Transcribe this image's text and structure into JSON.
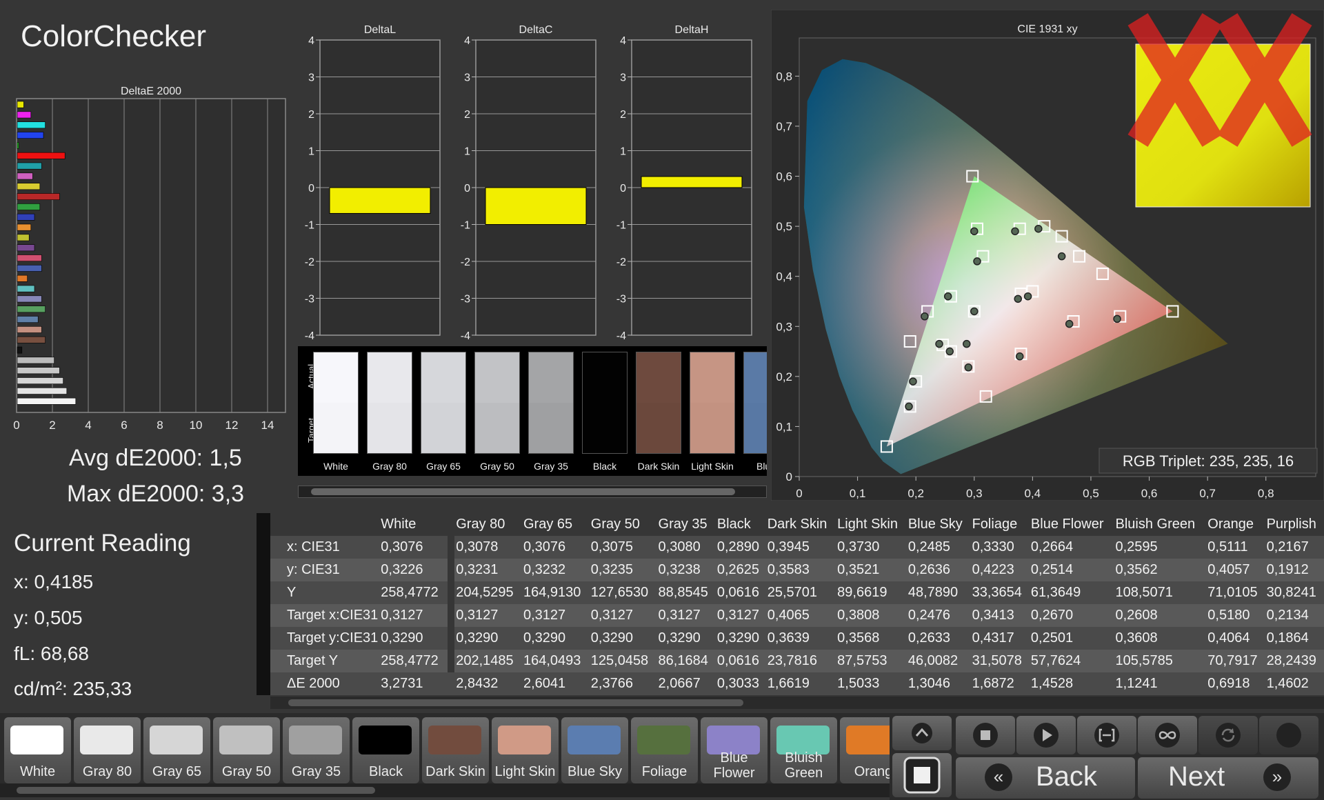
{
  "app": {
    "title": "ColorChecker"
  },
  "stats": {
    "avg": "Avg dE2000: 1,5",
    "max": "Max dE2000: 3,3"
  },
  "current_reading": {
    "title": "Current Reading",
    "x": "x: 0,4185",
    "y": "y: 0,505",
    "fl": "fL: 68,68",
    "cdm2": "cd/m²: 235,33"
  },
  "colors": {
    "delta_bar": "#f2ee00",
    "bg": "#363636",
    "plot_bg": "#2e2e2e"
  },
  "chart_data": [
    {
      "type": "bar",
      "orientation": "horizontal",
      "title": "DeltaE 2000",
      "xlim": [
        0,
        15
      ],
      "xticks": [
        0,
        2,
        4,
        6,
        8,
        10,
        12,
        14
      ],
      "grid": true,
      "values": [
        {
          "v": 0.4,
          "c": "#e8e800"
        },
        {
          "v": 0.8,
          "c": "#ee22ee"
        },
        {
          "v": 1.6,
          "c": "#22e0e0"
        },
        {
          "v": 1.5,
          "c": "#2244ee"
        },
        {
          "v": 0.1,
          "c": "#22cc22"
        },
        {
          "v": 2.7,
          "c": "#ee1111"
        },
        {
          "v": 1.4,
          "c": "#20a0a8"
        },
        {
          "v": 0.9,
          "c": "#d060c0"
        },
        {
          "v": 1.3,
          "c": "#d8cc30"
        },
        {
          "v": 2.4,
          "c": "#b82828"
        },
        {
          "v": 1.3,
          "c": "#30a040"
        },
        {
          "v": 1.0,
          "c": "#3040b8"
        },
        {
          "v": 0.8,
          "c": "#e89030"
        },
        {
          "v": 0.7,
          "c": "#c0c030"
        },
        {
          "v": 1.0,
          "c": "#784890"
        },
        {
          "v": 1.4,
          "c": "#d05070"
        },
        {
          "v": 1.4,
          "c": "#4860b0"
        },
        {
          "v": 0.6,
          "c": "#e07828"
        },
        {
          "v": 1.0,
          "c": "#60c0c0"
        },
        {
          "v": 1.4,
          "c": "#8888b8"
        },
        {
          "v": 1.6,
          "c": "#58a060"
        },
        {
          "v": 1.2,
          "c": "#6080a8"
        },
        {
          "v": 1.4,
          "c": "#c49080"
        },
        {
          "v": 1.6,
          "c": "#785040"
        },
        {
          "v": 0.3,
          "c": "#111111"
        },
        {
          "v": 2.1,
          "c": "#bbbbbb"
        },
        {
          "v": 2.4,
          "c": "#c8c8c8"
        },
        {
          "v": 2.6,
          "c": "#d6d6d6"
        },
        {
          "v": 2.8,
          "c": "#e4e4e4"
        },
        {
          "v": 3.3,
          "c": "#f4f4f4"
        }
      ]
    },
    {
      "type": "bar",
      "title": "DeltaL",
      "ylim": [
        -4,
        4
      ],
      "yticks": [
        4,
        3,
        2,
        1,
        0,
        -1,
        -2,
        -3,
        -4
      ],
      "values": [
        -0.7
      ]
    },
    {
      "type": "bar",
      "title": "DeltaC",
      "ylim": [
        -4,
        4
      ],
      "yticks": [
        4,
        3,
        2,
        1,
        0,
        -1,
        -2,
        -3,
        -4
      ],
      "values": [
        -1.0
      ]
    },
    {
      "type": "bar",
      "title": "DeltaH",
      "ylim": [
        -4,
        4
      ],
      "yticks": [
        4,
        3,
        2,
        1,
        0,
        -1,
        -2,
        -3,
        -4
      ],
      "values": [
        0.3
      ]
    },
    {
      "type": "scatter",
      "title": "CIE 1931 xy",
      "xlim": [
        0,
        0.85
      ],
      "ylim": [
        0,
        0.85
      ],
      "xticks": [
        "0",
        "0,1",
        "0,2",
        "0,3",
        "0,4",
        "0,5",
        "0,6",
        "0,7",
        "0,8"
      ],
      "yticks": [
        "0",
        "0,1",
        "0,2",
        "0,3",
        "0,4",
        "0,5",
        "0,6",
        "0,7",
        "0,8"
      ],
      "targets": [
        [
          0.297,
          0.6
        ],
        [
          0.305,
          0.495
        ],
        [
          0.378,
          0.495
        ],
        [
          0.42,
          0.5
        ],
        [
          0.45,
          0.48
        ],
        [
          0.48,
          0.44
        ],
        [
          0.52,
          0.405
        ],
        [
          0.315,
          0.44
        ],
        [
          0.38,
          0.365
        ],
        [
          0.4,
          0.37
        ],
        [
          0.3,
          0.33
        ],
        [
          0.22,
          0.33
        ],
        [
          0.26,
          0.36
        ],
        [
          0.19,
          0.27
        ],
        [
          0.246,
          0.263
        ],
        [
          0.26,
          0.25
        ],
        [
          0.29,
          0.22
        ],
        [
          0.38,
          0.245
        ],
        [
          0.47,
          0.31
        ],
        [
          0.55,
          0.32
        ],
        [
          0.64,
          0.33
        ],
        [
          0.2,
          0.19
        ],
        [
          0.19,
          0.14
        ],
        [
          0.15,
          0.06
        ],
        [
          0.32,
          0.16
        ]
      ],
      "actuals": [
        [
          0.3,
          0.49
        ],
        [
          0.37,
          0.49
        ],
        [
          0.305,
          0.43
        ],
        [
          0.375,
          0.355
        ],
        [
          0.392,
          0.36
        ],
        [
          0.3,
          0.33
        ],
        [
          0.255,
          0.36
        ],
        [
          0.215,
          0.32
        ],
        [
          0.24,
          0.265
        ],
        [
          0.258,
          0.25
        ],
        [
          0.29,
          0.218
        ],
        [
          0.378,
          0.24
        ],
        [
          0.463,
          0.305
        ],
        [
          0.545,
          0.315
        ],
        [
          0.45,
          0.44
        ],
        [
          0.41,
          0.495
        ],
        [
          0.195,
          0.19
        ],
        [
          0.188,
          0.14
        ],
        [
          0.287,
          0.265
        ]
      ],
      "inset": {
        "color": "#ebeb10",
        "label": "RGB Triplet: 235, 235, 16"
      }
    }
  ],
  "swatch_strip": {
    "actual_label": "Actual",
    "target_label": "Target",
    "swatches": [
      {
        "label": "White",
        "a": "#f7f7fb",
        "t": "#f4f4f8"
      },
      {
        "label": "Gray 80",
        "a": "#e8e8ec",
        "t": "#e4e4e8"
      },
      {
        "label": "Gray 65",
        "a": "#d6d7db",
        "t": "#d2d3d7"
      },
      {
        "label": "Gray 50",
        "a": "#c2c3c6",
        "t": "#bcbdc0"
      },
      {
        "label": "Gray 35",
        "a": "#a4a5a7",
        "t": "#9fa0a2"
      },
      {
        "label": "Black",
        "a": "#020202",
        "t": "#020202"
      },
      {
        "label": "Dark Skin",
        "a": "#6e4a3e",
        "t": "#6b483c"
      },
      {
        "label": "Light Skin",
        "a": "#c69584",
        "t": "#c39281"
      },
      {
        "label": "Blue",
        "a": "#5a7aa6",
        "t": "#5878a4"
      }
    ]
  },
  "table": {
    "columns": [
      "White",
      "Gray 80",
      "Gray 65",
      "Gray 50",
      "Gray 35",
      "Black",
      "Dark Skin",
      "Light Skin",
      "Blue Sky",
      "Foliage",
      "Blue Flower",
      "Bluish Green",
      "Orange",
      "Purplish"
    ],
    "rows": [
      {
        "label": "x: CIE31",
        "values": [
          "0,3076",
          "0,3078",
          "0,3076",
          "0,3075",
          "0,3080",
          "0,2890",
          "0,3945",
          "0,3730",
          "0,2485",
          "0,3330",
          "0,2664",
          "0,2595",
          "0,5111",
          "0,2167"
        ]
      },
      {
        "label": "y: CIE31",
        "values": [
          "0,3226",
          "0,3231",
          "0,3232",
          "0,3235",
          "0,3238",
          "0,2625",
          "0,3583",
          "0,3521",
          "0,2636",
          "0,4223",
          "0,2514",
          "0,3562",
          "0,4057",
          "0,1912"
        ]
      },
      {
        "label": "Y",
        "values": [
          "258,4772",
          "204,5295",
          "164,9130",
          "127,6530",
          "88,8545",
          "0,0616",
          "25,5701",
          "89,6619",
          "48,7890",
          "33,3654",
          "61,3649",
          "108,5071",
          "71,0105",
          "30,8241"
        ]
      },
      {
        "label": "Target x:CIE31",
        "values": [
          "0,3127",
          "0,3127",
          "0,3127",
          "0,3127",
          "0,3127",
          "0,3127",
          "0,4065",
          "0,3808",
          "0,2476",
          "0,3413",
          "0,2670",
          "0,2608",
          "0,5180",
          "0,2134"
        ]
      },
      {
        "label": "Target y:CIE31",
        "values": [
          "0,3290",
          "0,3290",
          "0,3290",
          "0,3290",
          "0,3290",
          "0,3290",
          "0,3639",
          "0,3568",
          "0,2633",
          "0,4317",
          "0,2501",
          "0,3608",
          "0,4064",
          "0,1864"
        ]
      },
      {
        "label": "Target Y",
        "values": [
          "258,4772",
          "202,1485",
          "164,0493",
          "125,0458",
          "86,1684",
          "0,0616",
          "23,7816",
          "87,5753",
          "46,0082",
          "31,5078",
          "57,7624",
          "105,5785",
          "70,7917",
          "28,2439"
        ]
      },
      {
        "label": "ΔE 2000",
        "values": [
          "3,2731",
          "2,8432",
          "2,6041",
          "2,3766",
          "2,0667",
          "0,3033",
          "1,6619",
          "1,5033",
          "1,3046",
          "1,6872",
          "1,4528",
          "1,1241",
          "0,6918",
          "1,4602"
        ]
      }
    ]
  },
  "patches": [
    {
      "label": "White",
      "color": "#ffffff"
    },
    {
      "label": "Gray 80",
      "color": "#e9e9e9"
    },
    {
      "label": "Gray 65",
      "color": "#d6d6d6"
    },
    {
      "label": "Gray 50",
      "color": "#c0c0c0"
    },
    {
      "label": "Gray 35",
      "color": "#a0a0a0"
    },
    {
      "label": "Black",
      "color": "#000000"
    },
    {
      "label": "Dark Skin",
      "color": "#724c3e"
    },
    {
      "label": "Light Skin",
      "color": "#d09a86"
    },
    {
      "label": "Blue Sky",
      "color": "#5b7db0"
    },
    {
      "label": "Foliage",
      "color": "#56703e"
    },
    {
      "label": "Blue\nFlower",
      "color": "#8c82c8"
    },
    {
      "label": "Bluish\nGreen",
      "color": "#68c8b2"
    },
    {
      "label": "Orang",
      "color": "#e07a26"
    }
  ],
  "controls": {
    "back_label": "Back",
    "next_label": "Next",
    "icons": [
      "stop-icon",
      "play-icon",
      "bracket-icon",
      "loop-icon",
      "refresh-icon",
      "record-icon"
    ]
  }
}
